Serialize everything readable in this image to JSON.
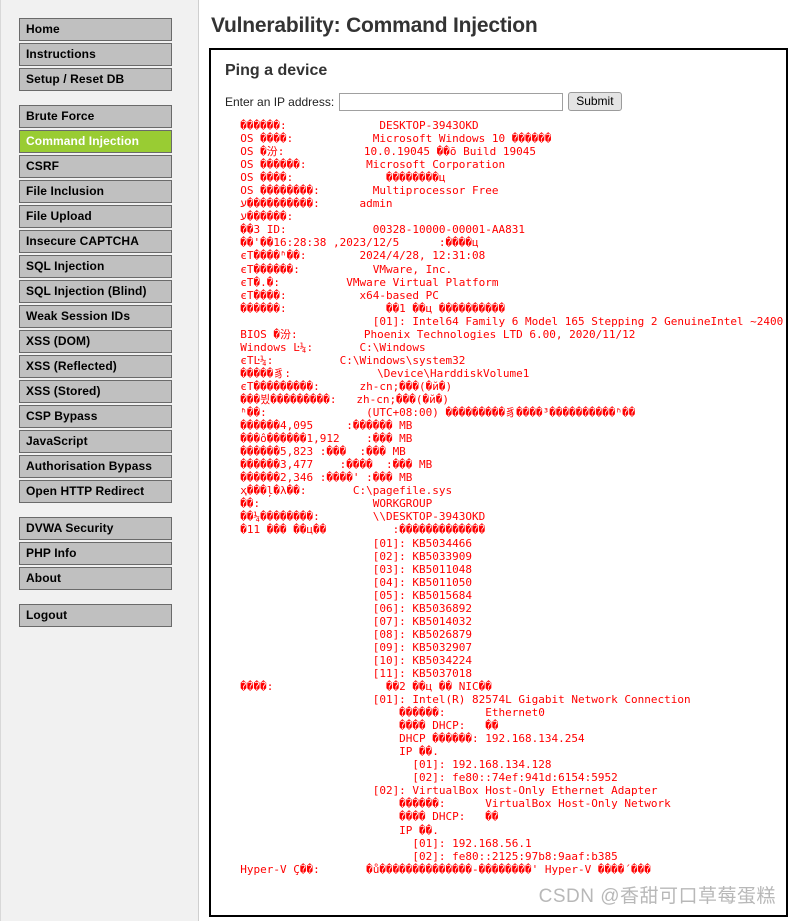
{
  "sidebar": {
    "groups": [
      {
        "items": [
          {
            "label": "Home",
            "name": "sidebar-item-home",
            "active": false
          },
          {
            "label": "Instructions",
            "name": "sidebar-item-instructions",
            "active": false
          },
          {
            "label": "Setup / Reset DB",
            "name": "sidebar-item-setup-reset-db",
            "active": false
          }
        ]
      },
      {
        "items": [
          {
            "label": "Brute Force",
            "name": "sidebar-item-brute-force",
            "active": false
          },
          {
            "label": "Command Injection",
            "name": "sidebar-item-command-injection",
            "active": true
          },
          {
            "label": "CSRF",
            "name": "sidebar-item-csrf",
            "active": false
          },
          {
            "label": "File Inclusion",
            "name": "sidebar-item-file-inclusion",
            "active": false
          },
          {
            "label": "File Upload",
            "name": "sidebar-item-file-upload",
            "active": false
          },
          {
            "label": "Insecure CAPTCHA",
            "name": "sidebar-item-insecure-captcha",
            "active": false
          },
          {
            "label": "SQL Injection",
            "name": "sidebar-item-sql-injection",
            "active": false
          },
          {
            "label": "SQL Injection (Blind)",
            "name": "sidebar-item-sql-injection-blind",
            "active": false
          },
          {
            "label": "Weak Session IDs",
            "name": "sidebar-item-weak-session-ids",
            "active": false
          },
          {
            "label": "XSS (DOM)",
            "name": "sidebar-item-xss-dom",
            "active": false
          },
          {
            "label": "XSS (Reflected)",
            "name": "sidebar-item-xss-reflected",
            "active": false
          },
          {
            "label": "XSS (Stored)",
            "name": "sidebar-item-xss-stored",
            "active": false
          },
          {
            "label": "CSP Bypass",
            "name": "sidebar-item-csp-bypass",
            "active": false
          },
          {
            "label": "JavaScript",
            "name": "sidebar-item-javascript",
            "active": false
          },
          {
            "label": "Authorisation Bypass",
            "name": "sidebar-item-authorisation-bypass",
            "active": false
          },
          {
            "label": "Open HTTP Redirect",
            "name": "sidebar-item-open-http-redirect",
            "active": false
          }
        ]
      },
      {
        "items": [
          {
            "label": "DVWA Security",
            "name": "sidebar-item-dvwa-security",
            "active": false
          },
          {
            "label": "PHP Info",
            "name": "sidebar-item-php-info",
            "active": false
          },
          {
            "label": "About",
            "name": "sidebar-item-about",
            "active": false
          }
        ]
      },
      {
        "items": [
          {
            "label": "Logout",
            "name": "sidebar-item-logout",
            "active": false
          }
        ]
      }
    ]
  },
  "main": {
    "page_title": "Vulnerability: Command Injection",
    "section_title": "Ping a device",
    "form": {
      "label": "Enter an IP address:",
      "input_value": "",
      "input_placeholder": "",
      "submit_label": "Submit"
    },
    "command_output": "  ������:              DESKTOP-3943OKD\n  OS ����:            Microsoft Windows 10 ������\n  OS �汾:            10.0.19045 ��ō Build 19045\n  OS ������:         Microsoft Corporation\n  OS ����:              ��������ц\n  OS ��������:        Multiprocessor Free\n  ע����������:      admin\n  ע������:\n  ��3 ID:             00328-10000-00001-AA831\n  ��'��16:28:38 ,2023/12/5      :����ц\n  єT����ʱ��:        2024/4/28, 12:31:08\n  єT������:           VMware, Inc.\n  єT�.�:          VMware Virtual Platform\n  єT����:           x64-based PC\n  ������:               ��1 ��ц ����������\n                      [01]: Intel64 Family 6 Model 165 Stepping 2 GenuineIntel ~2400 \n  BIOS �汾:          Phoenix Technologies LTD 6.00, 2020/11/12\n  Windows Ŀ¼:       C:\\Windows\n  єTĿ¼:          C:\\Windows\\system32\n  �����豸:             \\Device\\HarddiskVolume1\n  єT���������:      zh-cn;���(�й�)\n  ���뷨���������:   zh-cn;���(�й�)\n  ʱ��:               (UTC+08:00) ���������豸����³����������ʱ��\n  ������4,095     :������ MB\n  ���ô������1,912    :��� MB\n  ������5,823 :���  :��� MB\n  ������3,477    :����  :��� MB\n  ������2,346 :����' :��� MB\n  ҳ���ļ�λ��:       C:\\pagefile.sys\n  ��:                 WORKGROUP\n  ��¼��������:        \\\\DESKTOP-3943OKD\n  �޲��� 11 ��ц��          :�������������\n                      [01]: KB5034466\n                      [02]: KB5033909\n                      [03]: KB5011048\n                      [04]: KB5011050\n                      [05]: KB5015684\n                      [06]: KB5036892\n                      [07]: KB5014032\n                      [08]: KB5026879\n                      [09]: KB5032907\n                      [10]: KB5034224\n                      [11]: KB5037018\n  ����:                 ��2 ��ц �� NIC��\n                      [01]: Intel(R) 82574L Gigabit Network Connection\n                          ������:      Ethernet0\n                          ���� DHCP:   ��\n                          DHCP ������: 192.168.134.254\n                          IP ��.\n                            [01]: 192.168.134.128\n                            [02]: fe80::74ef:941d:6154:5952\n                      [02]: VirtualBox Host-Only Ethernet Adapter\n                          ������:      VirtualBox Host-Only Network\n                          ���� DHCP:   ��\n                          IP ��.\n                            [01]: 192.168.56.1\n                            [02]: fe80::2125:97b8:9aaf:b385\n  Hyper-V Ҫ��:       �ů�򵥵�������������-��򵥵������' Hyper-V ����´���"
  },
  "watermark": {
    "text": "CSDN @香甜可口草莓蛋糕"
  },
  "colors": {
    "accent_green": "#99cc33",
    "sidebar_button": "#c0c0c0",
    "output_red": "#ff0000",
    "page_bg": "#ffffff",
    "sidebar_bg": "#f1f1f1"
  }
}
